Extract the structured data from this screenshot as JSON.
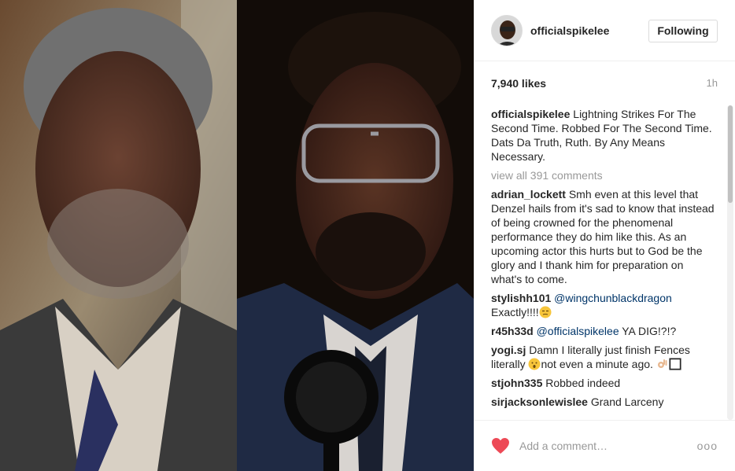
{
  "post": {
    "username": "officialspikelee",
    "follow_label": "Following",
    "likes": "7,940 likes",
    "time": "1h",
    "caption_user": "officialspikelee",
    "caption_text": "Lightning Strikes For The Second Time. Robbed For The Second Time. Dats Da Truth, Ruth. By Any Means Necessary.",
    "view_all": "view all 391 comments"
  },
  "comments": [
    {
      "user": "adrian_lockett",
      "text": "Smh even at this level that Denzel hails from it's sad to know that instead of being crowned for the phenomenal performance they do him like this. As an upcoming actor this hurts but to God be the glory and I thank him for preparation on what's to come."
    },
    {
      "user": "stylishh101",
      "mention": "@wingchunblackdragon",
      "text": "Exactly!!!!"
    },
    {
      "user": "r45h33d",
      "mention": "@officialspikelee",
      "text": "YA DIG!?!?"
    },
    {
      "user": "yogi.sj",
      "text_a": "Damn I literally just finish Fences literally",
      "text_b": "not even a minute ago."
    },
    {
      "user": "stjohn335",
      "text": "Robbed indeed"
    },
    {
      "user": "sirjacksonlewislee",
      "text": "Grand Larceny"
    }
  ],
  "footer": {
    "placeholder": "Add a comment…",
    "more": "ooo"
  },
  "icons": {
    "heart": "heart-icon",
    "emoji_unamused": "unamused-face-icon",
    "emoji_astonished": "astonished-face-icon",
    "emoji_ok_hand": "ok-hand-icon"
  },
  "colors": {
    "heart": "#ed4956",
    "mention": "#003569",
    "muted": "#999999"
  }
}
